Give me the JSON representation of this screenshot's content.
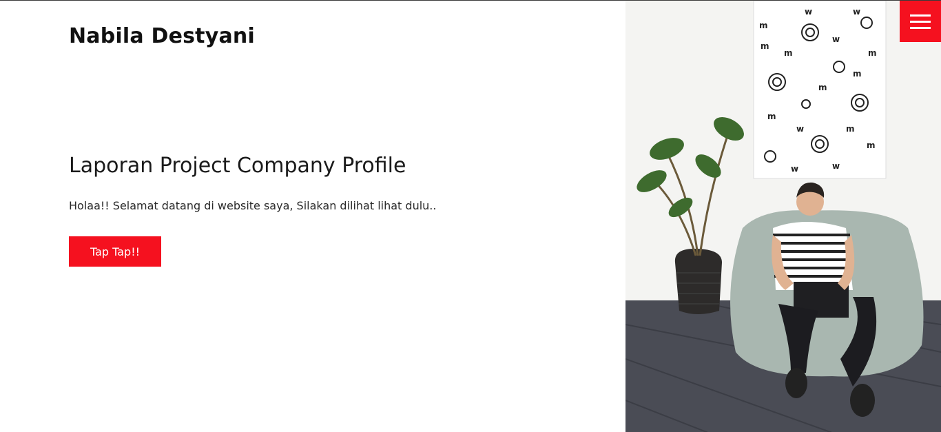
{
  "header": {
    "brand": "Nabila Destyani",
    "menu_icon": "hamburger-menu-icon"
  },
  "hero": {
    "title": "Laporan Project Company Profile",
    "subtitle": "Holaa!! Selamat datang di website saya, Silakan dilihat lihat dulu..",
    "cta_label": "Tap Tap!!"
  },
  "colors": {
    "accent": "#f5111f",
    "text": "#111111",
    "background": "#ffffff"
  }
}
